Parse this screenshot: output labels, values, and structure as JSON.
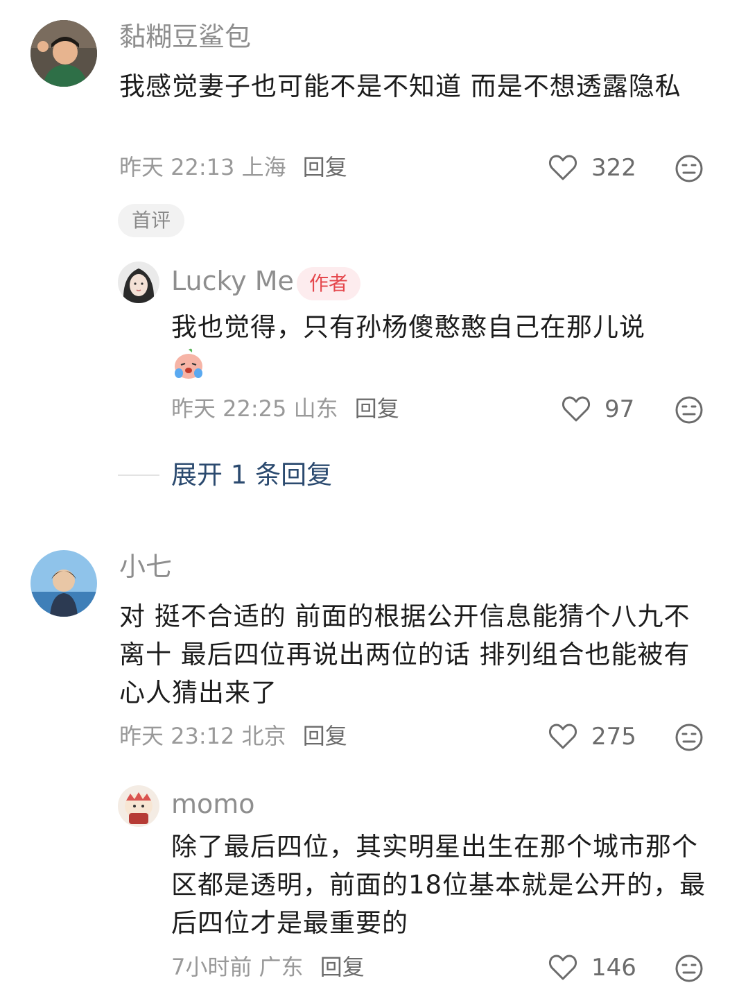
{
  "comments": [
    {
      "user": "黏糊豆鲨包",
      "text": "我感觉妻子也可能不是不知道 而是不想透露隐私",
      "time": "昨天 22:13",
      "location": "上海",
      "reply": "回复",
      "likes": "322",
      "badge": "首评",
      "replies": [
        {
          "user": "Lucky Me",
          "author_badge": "作者",
          "text": "我也觉得，只有孙杨傻憨憨自己在那儿说",
          "emoji": "crying-peach-emoji",
          "time": "昨天 22:25",
          "location": "山东",
          "reply": "回复",
          "likes": "97"
        }
      ],
      "expand_label": "展开 1 条回复"
    },
    {
      "user": "小七",
      "text": "对 挺不合适的 前面的根据公开信息能猜个八九不离十 最后四位再说出两位的话 排列组合也能被有心人猜出来了",
      "time": "昨天 23:12",
      "location": "北京",
      "reply": "回复",
      "likes": "275",
      "replies": [
        {
          "user": "momo",
          "text": "除了最后四位，其实明星出生在那个城市那个区都是透明，前面的18位基本就是公开的，最后四位才是最重要的",
          "time": "7小时前",
          "location": "广东",
          "reply": "回复",
          "likes": "146"
        }
      ]
    }
  ],
  "icons": {
    "like": "heart-outline-icon",
    "dislike": "meh-face-icon"
  },
  "colors": {
    "author_badge_bg": "#fdecee",
    "author_badge_text": "#e5484d",
    "expand_text": "#2b4a6f"
  }
}
